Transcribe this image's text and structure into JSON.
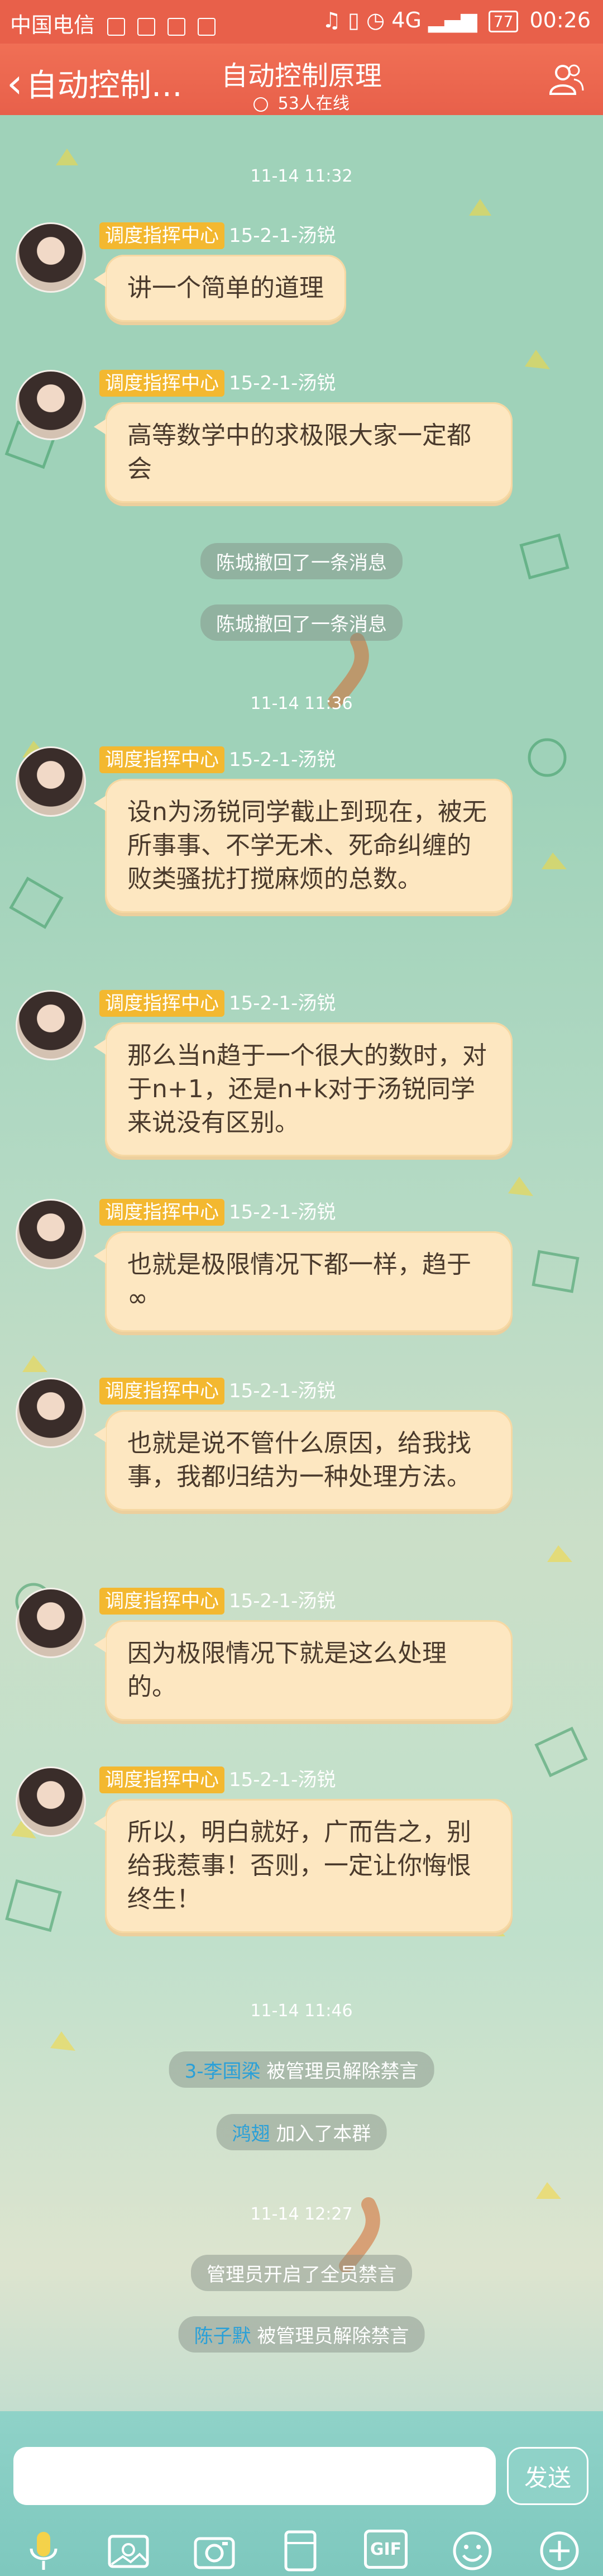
{
  "status_bar": {
    "carrier": "中国电信",
    "network": "4G",
    "battery": "77",
    "time": "00:26"
  },
  "header": {
    "back_label": "自动控制…",
    "title": "自动控制原理",
    "online": "53人在线"
  },
  "timestamps": [
    "11-14 11:32",
    "11-14 11:36",
    "11-14 11:46",
    "11-14 12:27"
  ],
  "messages": [
    {
      "role": "调度指挥中心",
      "sender": "15-2-1-汤锐",
      "text": "讲一个简单的道理"
    },
    {
      "role": "调度指挥中心",
      "sender": "15-2-1-汤锐",
      "text": "高等数学中的求极限大家一定都会"
    },
    {
      "role": "调度指挥中心",
      "sender": "15-2-1-汤锐",
      "text": "设n为汤锐同学截止到现在，被无所事事、不学无术、死命纠缠的败类骚扰打搅麻烦的总数。"
    },
    {
      "role": "调度指挥中心",
      "sender": "15-2-1-汤锐",
      "text": "那么当n趋于一个很大的数时，对于n+1，还是n+k对于汤锐同学来说没有区别。"
    },
    {
      "role": "调度指挥中心",
      "sender": "15-2-1-汤锐",
      "text": "也就是极限情况下都一样，趋于∞"
    },
    {
      "role": "调度指挥中心",
      "sender": "15-2-1-汤锐",
      "text": "也就是说不管什么原因，给我找事，我都归结为一种处理方法。"
    },
    {
      "role": "调度指挥中心",
      "sender": "15-2-1-汤锐",
      "text": "因为极限情况下就是这么处理的。"
    },
    {
      "role": "调度指挥中心",
      "sender": "15-2-1-汤锐",
      "text": "所以，明白就好，广而告之，别给我惹事！否则，一定让你悔恨终生！"
    }
  ],
  "system": [
    {
      "user": "",
      "text": "陈城撤回了一条消息"
    },
    {
      "user": "",
      "text": "陈城撤回了一条消息"
    },
    {
      "user": "3-李国梁",
      "text": " 被管理员解除禁言"
    },
    {
      "user": "鸿翅",
      "text": " 加入了本群"
    },
    {
      "user": "",
      "text": "管理员开启了全员禁言"
    },
    {
      "user": "陈子默",
      "text": " 被管理员解除禁言"
    }
  ],
  "input": {
    "placeholder": "",
    "send_label": "发送",
    "gif_label": "GIF"
  },
  "icons": [
    "microphone-icon",
    "image-icon",
    "camera-icon",
    "note-icon",
    "emoji-icon",
    "plus-icon"
  ],
  "colors": {
    "header": "#e8604a",
    "bubble": "#fde7c1",
    "badge": "#f3b830",
    "input_bar": "#8fd2c8"
  }
}
